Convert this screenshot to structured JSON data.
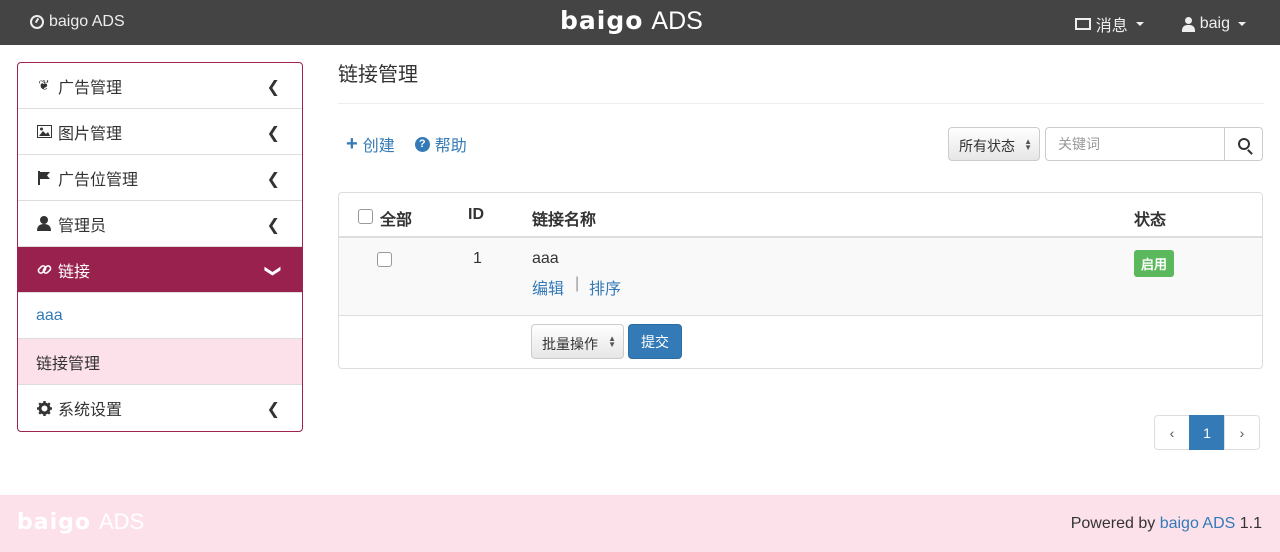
{
  "navbar": {
    "brand_left": "baigo ADS",
    "logo_word": "baigo",
    "logo_suffix": "ADS",
    "messages_label": "消息",
    "user_label": "baig"
  },
  "sidebar": {
    "items": [
      {
        "label": "广告管理",
        "icon": "leaf-icon"
      },
      {
        "label": "图片管理",
        "icon": "picture-icon"
      },
      {
        "label": "广告位管理",
        "icon": "flag-icon"
      },
      {
        "label": "管理员",
        "icon": "user-icon"
      },
      {
        "label": "链接",
        "icon": "link-icon"
      },
      {
        "label": "系统设置",
        "icon": "cog-icon"
      }
    ],
    "sub_items": [
      {
        "label": "aaa"
      },
      {
        "label": "链接管理"
      }
    ]
  },
  "main": {
    "title": "链接管理",
    "create_label": "创建",
    "help_label": "帮助",
    "status_filter": "所有状态",
    "search_placeholder": "关键词"
  },
  "table": {
    "headers": {
      "select_all": "全部",
      "id": "ID",
      "name": "链接名称",
      "status": "状态"
    },
    "rows": [
      {
        "id": "1",
        "name": "aaa",
        "edit": "编辑",
        "sep": "|",
        "sort": "排序",
        "status": "启用"
      }
    ],
    "bulk_label": "批量操作",
    "submit_label": "提交"
  },
  "pagination": {
    "prev": "‹",
    "current": "1",
    "next": "›"
  },
  "footer": {
    "logo_word": "baigo",
    "logo_suffix": "ADS",
    "powered_prefix": "Powered by",
    "powered_link": "baigo ADS",
    "version": "1.1"
  },
  "colors": {
    "navbar": "#444444",
    "sidebar_active": "#98224d",
    "sidebar_current": "#fde1ea",
    "primary": "#337ab7",
    "success": "#5cb85c"
  }
}
